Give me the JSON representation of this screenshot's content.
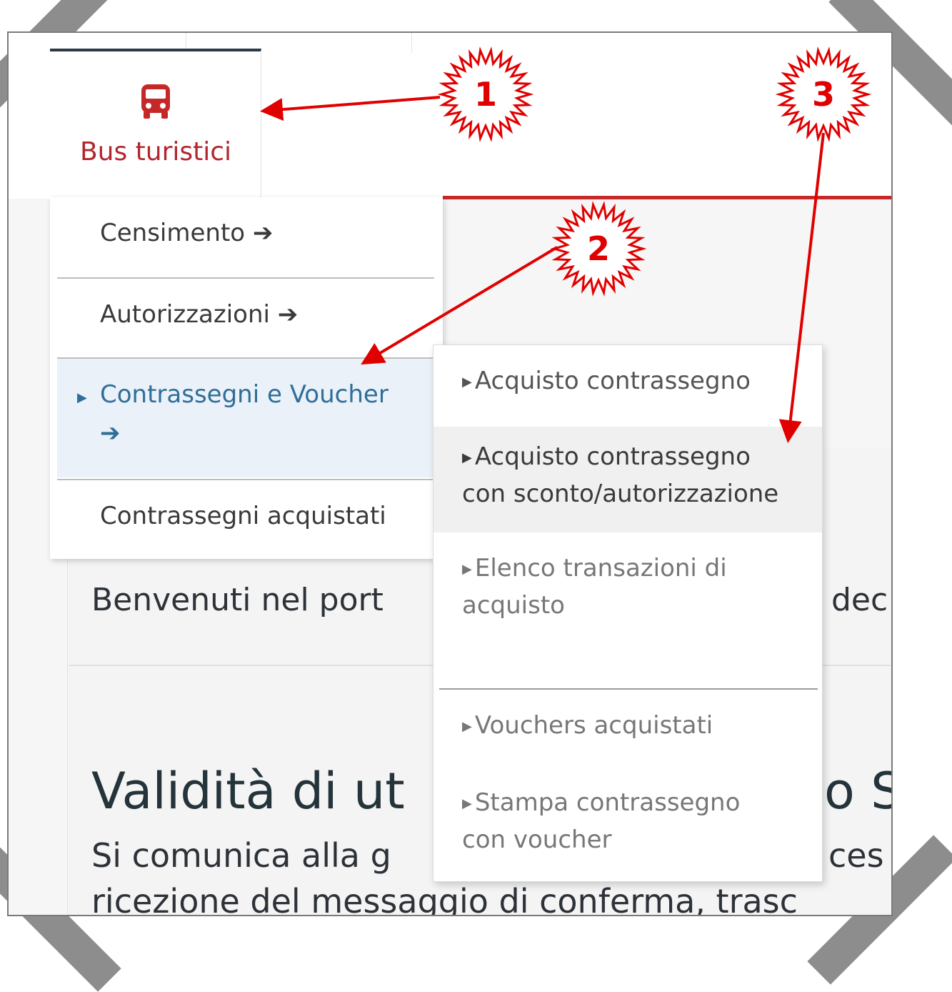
{
  "tab": {
    "label": "Bus turistici",
    "icon": "bus-icon",
    "accent": "#c62828"
  },
  "menu": {
    "items": [
      {
        "label": "Censimento",
        "arrow": "➔"
      },
      {
        "label": "Autorizzazioni",
        "arrow": "➔"
      },
      {
        "label": "Contrassegni e Voucher",
        "arrow": "➔",
        "active": true
      },
      {
        "label": "Contrassegni acquistati"
      }
    ]
  },
  "submenu": {
    "items": [
      {
        "line1": "Acquisto contrassegno",
        "line2": "",
        "color": "#555555"
      },
      {
        "line1": "Acquisto contrassegno",
        "line2": "con sconto/autorizzazione",
        "color": "#3a3a3a",
        "hovered": true
      },
      {
        "line1": "Elenco transazioni di",
        "line2": "acquisto",
        "color": "#777777"
      },
      {
        "line1": "Vouchers acquistati",
        "line2": "",
        "color": "#777777"
      },
      {
        "line1": "Stampa contrassegno",
        "line2": "con voucher",
        "color": "#777777"
      }
    ]
  },
  "page": {
    "welcome": "Benvenuti nel port",
    "welcome_tail": "dec",
    "heading": "Validità di ut",
    "heading_tail": "o S",
    "para1": "Si comunica alla g",
    "para1_tail": "ces",
    "para2": "ricezione del messaggio di conferma, trasc"
  },
  "annotations": {
    "badge1": "1",
    "badge2": "2",
    "badge3": "3",
    "color": "#e00000"
  }
}
